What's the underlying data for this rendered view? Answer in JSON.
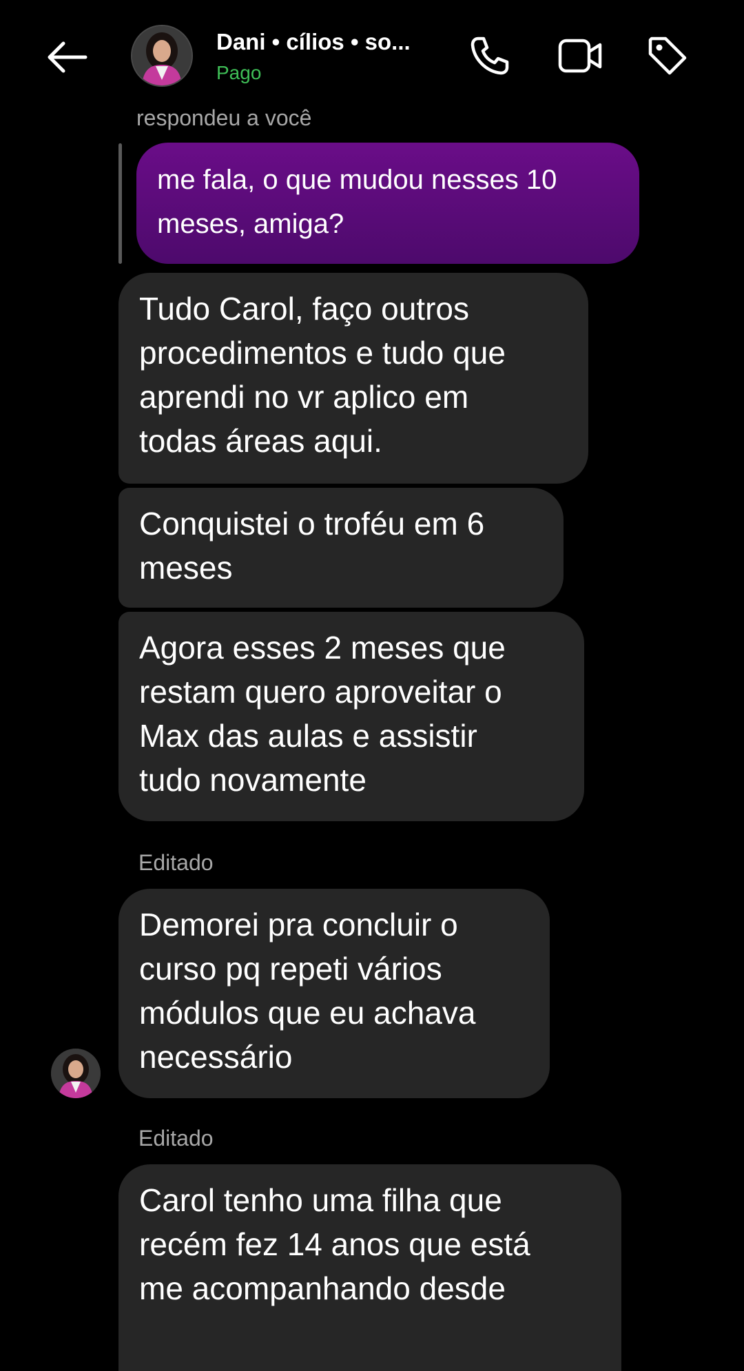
{
  "header": {
    "contact_name": "Dani • cílios • so...",
    "status": "Pago"
  },
  "thread": {
    "reply_label": "respondeu a você",
    "sent_message": "me fala, o que mudou nesses 10\nmeses, amiga?",
    "messages": [
      "Tudo Carol, faço outros\nprocedimentos e tudo que\naprendi no vr aplico em\ntodas áreas aqui.",
      "Conquistei o troféu em 6\nmeses",
      "Agora esses 2 meses que\nrestam quero aproveitar o\nMax das aulas e assistir\ntudo novamente",
      "Demorei pra concluir o\ncurso pq repeti vários\nmódulos que eu achava\nnecessário",
      "Carol tenho uma filha que\nrecém fez 14 anos que está\nme acompanhando desde"
    ],
    "edited_labels": [
      "Editado",
      "Editado"
    ]
  },
  "colors": {
    "background": "#000000",
    "received_bubble": "#262626",
    "sent_bubble": "#5a0b7a",
    "status_green": "#3fbf57",
    "meta_text": "#a8a8a8"
  },
  "icons": [
    "back-arrow-icon",
    "phone-icon",
    "video-camera-icon",
    "tag-icon"
  ]
}
